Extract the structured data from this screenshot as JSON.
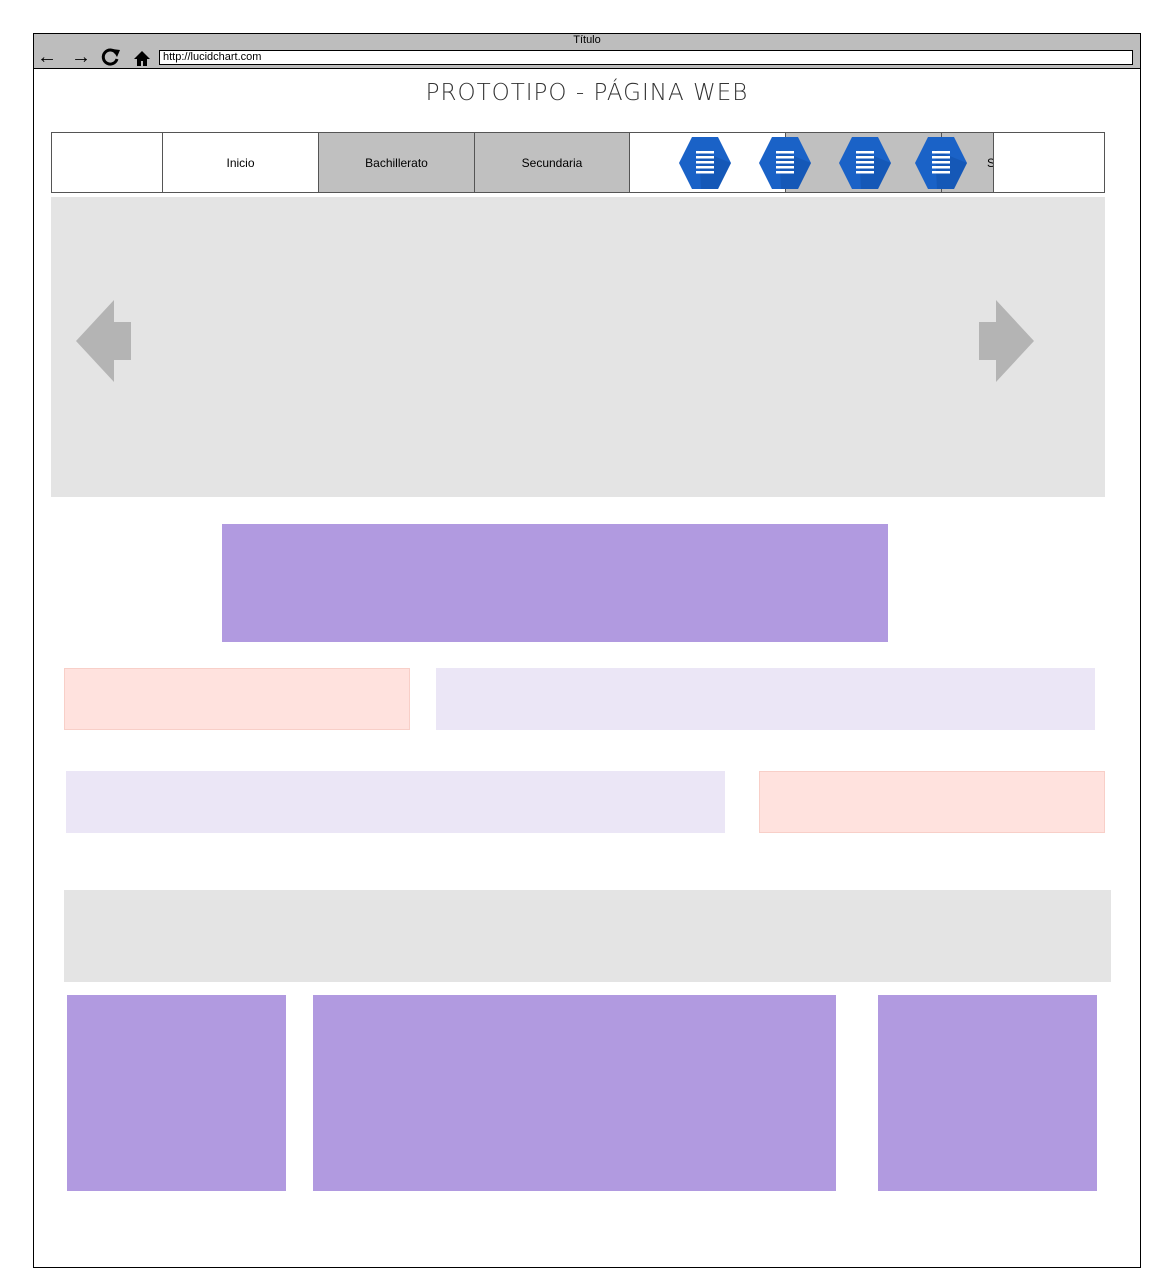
{
  "window": {
    "title": "Título"
  },
  "browser": {
    "url": "http://lucidchart.com"
  },
  "page": {
    "title": "PROTOTIPO -  PÁGINA WEB"
  },
  "nav": {
    "items": [
      {
        "label": ""
      },
      {
        "label": "Inicio"
      },
      {
        "label": "Bachillerato"
      },
      {
        "label": "Secundaria"
      },
      {
        "label": ""
      },
      {
        "label": "S"
      },
      {
        "label": ""
      }
    ]
  },
  "colors": {
    "chrome": "#bdbdbd",
    "nav_active": "#c0c0c0",
    "carousel": "#e4e4e4",
    "purple": "#b19ae0",
    "lavender": "#ebe6f6",
    "pink": "#ffe2de",
    "hex_icon": "#1a62c7"
  },
  "icons": {
    "nav_hex": "document-lines-icon",
    "carousel_prev": "arrow-left-icon",
    "carousel_next": "arrow-right-icon"
  }
}
